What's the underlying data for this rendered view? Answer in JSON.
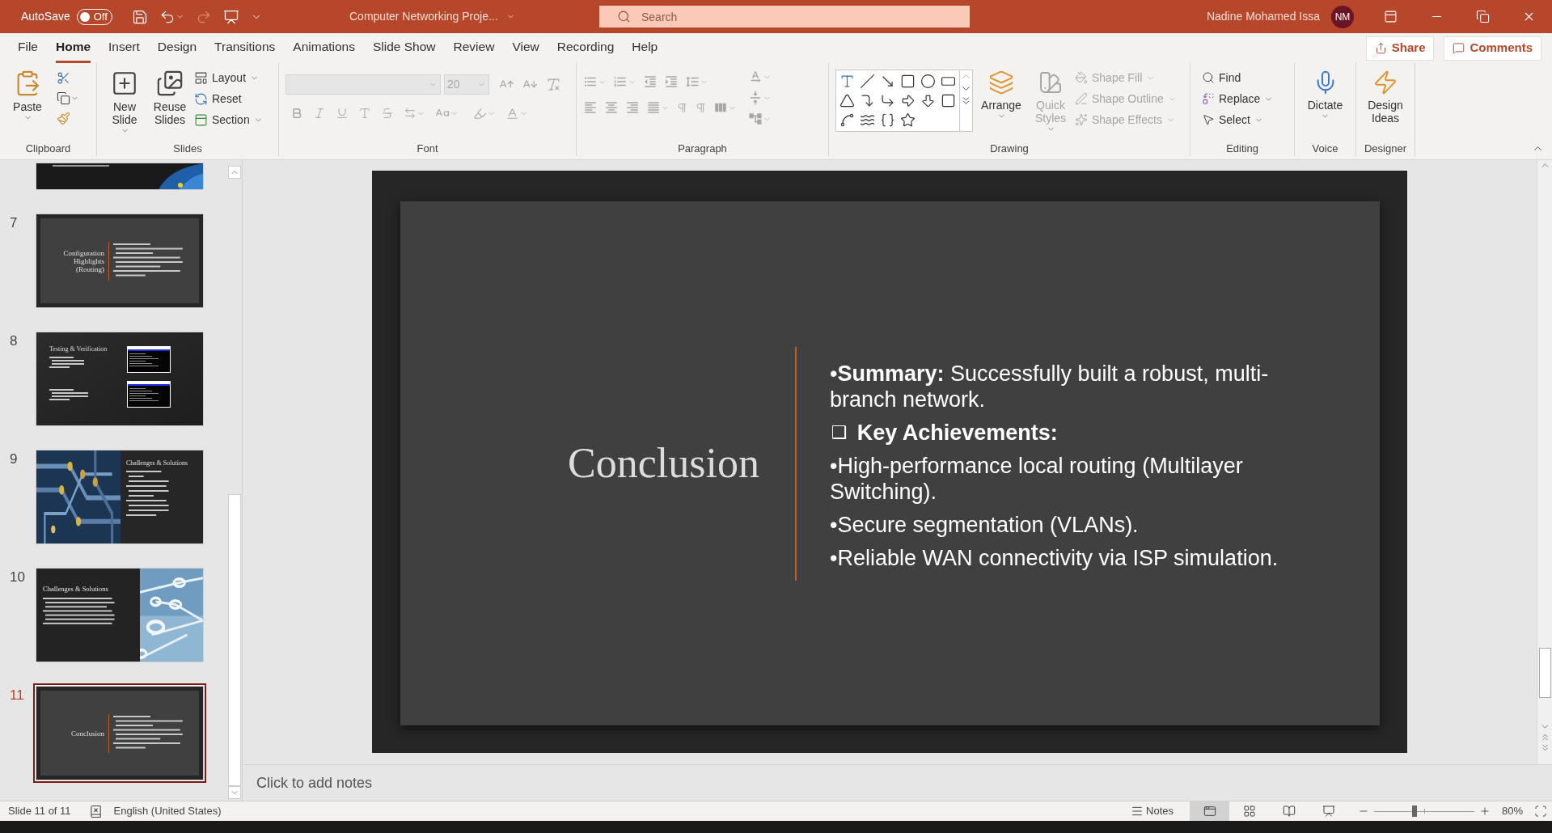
{
  "title_bar": {
    "autosave_label": "AutoSave",
    "autosave": {
      "on": false,
      "label": "Off"
    },
    "document_title": "Computer Networking Proje...",
    "search": {
      "placeholder": "Search"
    },
    "user_name": "Nadine Mohamed Issa",
    "user_initials": "NM"
  },
  "menu_tabs": [
    {
      "label": "File",
      "selected": false
    },
    {
      "label": "Home",
      "selected": true
    },
    {
      "label": "Insert",
      "selected": false
    },
    {
      "label": "Design",
      "selected": false
    },
    {
      "label": "Transitions",
      "selected": false
    },
    {
      "label": "Animations",
      "selected": false
    },
    {
      "label": "Slide Show",
      "selected": false
    },
    {
      "label": "Review",
      "selected": false
    },
    {
      "label": "View",
      "selected": false
    },
    {
      "label": "Recording",
      "selected": false
    },
    {
      "label": "Help",
      "selected": false
    }
  ],
  "share_button": "Share",
  "comments_button": "Comments",
  "ribbon": {
    "clipboard": {
      "label": "Clipboard",
      "paste": "Paste"
    },
    "slides": {
      "label": "Slides",
      "new_slide": "New Slide",
      "reuse_slides": "Reuse Slides",
      "layout": "Layout",
      "reset": "Reset",
      "section": "Section"
    },
    "font": {
      "label": "Font",
      "size": "20",
      "disabled": true
    },
    "paragraph": {
      "label": "Paragraph",
      "disabled": true
    },
    "drawing": {
      "label": "Drawing",
      "arrange": "Arrange",
      "quick_styles": "Quick Styles",
      "shape_fill": "Shape Fill",
      "shape_outline": "Shape Outline",
      "shape_effects": "Shape Effects",
      "styles_disabled": true
    },
    "editing": {
      "label": "Editing",
      "find": "Find",
      "replace": "Replace",
      "select": "Select"
    },
    "voice": {
      "label": "Voice",
      "dictate": "Dictate"
    },
    "designer": {
      "label": "Designer",
      "design_ideas": "Design Ideas"
    }
  },
  "slide_thumbnails": [
    {
      "kind": "photo-partial",
      "selected": false
    },
    {
      "number": "7",
      "kind": "split",
      "title": "Configuration Highlights (Routing)",
      "selected": false
    },
    {
      "number": "8",
      "kind": "screens",
      "title": "Testing & Verification",
      "selected": false
    },
    {
      "number": "9",
      "kind": "photo-left",
      "title": "Challenges & Solutions",
      "selected": false
    },
    {
      "number": "10",
      "kind": "photo-right",
      "title": "Challenges & Solutions",
      "selected": false
    },
    {
      "number": "11",
      "kind": "split",
      "title": "Conclusion",
      "selected": true
    }
  ],
  "slide": {
    "title": "Conclusion",
    "items": [
      {
        "kind": "bullet",
        "text": "•**Summary:** Successfully built a robust, multi-branch network."
      },
      {
        "kind": "checkbox-heading",
        "marker": "❑",
        "text": "**Key Achievements:**"
      },
      {
        "kind": "bullet",
        "text": "•High-performance local routing (Multilayer Switching)."
      },
      {
        "kind": "bullet",
        "text": "•Secure segmentation (VLANs)."
      },
      {
        "kind": "bullet",
        "text": "•Reliable WAN connectivity via ISP simulation."
      }
    ]
  },
  "notes": {
    "placeholder": "Click to add notes"
  },
  "status_bar": {
    "slide_indicator": "Slide 11 of 11",
    "language": "English (United States)",
    "notes_button": "Notes",
    "views": [
      {
        "selected": true
      },
      {
        "selected": false
      },
      {
        "selected": false
      },
      {
        "selected": false
      }
    ],
    "zoom": {
      "level": 0.4,
      "reading": "80%"
    }
  }
}
